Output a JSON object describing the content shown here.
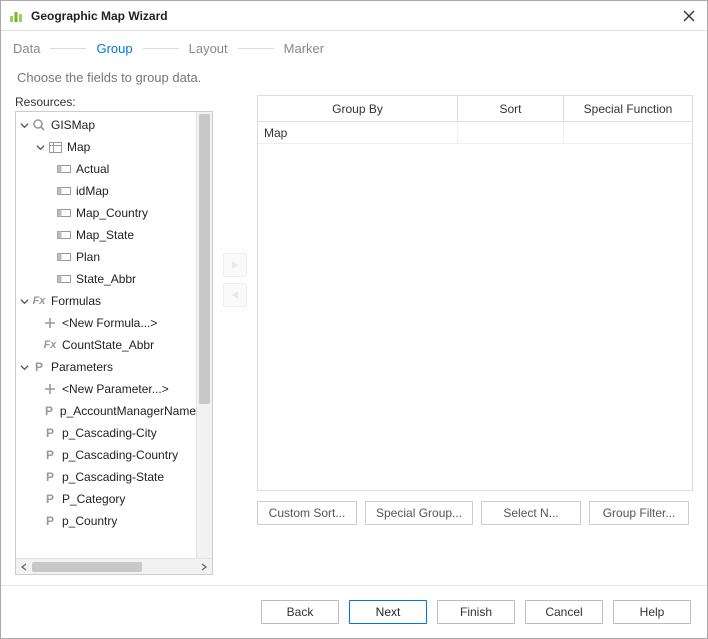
{
  "window": {
    "title": "Geographic Map Wizard"
  },
  "steps": {
    "data": "Data",
    "group": "Group",
    "layout": "Layout",
    "marker": "Marker",
    "active": "group"
  },
  "subtitle": "Choose the fields to group data.",
  "resources_label": "Resources:",
  "tree": {
    "gismap": "GISMap",
    "map": "Map",
    "fields": {
      "actual": "Actual",
      "idmap": "idMap",
      "map_country": "Map_Country",
      "map_state": "Map_State",
      "plan": "Plan",
      "state_abbr": "State_Abbr"
    },
    "formulas": "Formulas",
    "new_formula": "<New Formula...>",
    "countstate": "CountState_Abbr",
    "parameters": "Parameters",
    "new_parameter": "<New Parameter...>",
    "params": {
      "acct": "p_AccountManagerName",
      "cascity": "p_Cascading-City",
      "cascountry": "p_Cascading-Country",
      "casstate": "p_Cascading-State",
      "category": "P_Category",
      "country": "p_Country"
    }
  },
  "grid": {
    "headers": {
      "groupby": "Group By",
      "sort": "Sort",
      "special": "Special Function"
    },
    "rows": [
      {
        "groupby": "Map",
        "sort": "",
        "special": ""
      }
    ]
  },
  "grid_buttons": {
    "custom_sort": "Custom Sort...",
    "special_group": "Special Group...",
    "select_n": "Select N...",
    "group_filter": "Group Filter..."
  },
  "footer": {
    "back": "Back",
    "next": "Next",
    "finish": "Finish",
    "cancel": "Cancel",
    "help": "Help"
  }
}
